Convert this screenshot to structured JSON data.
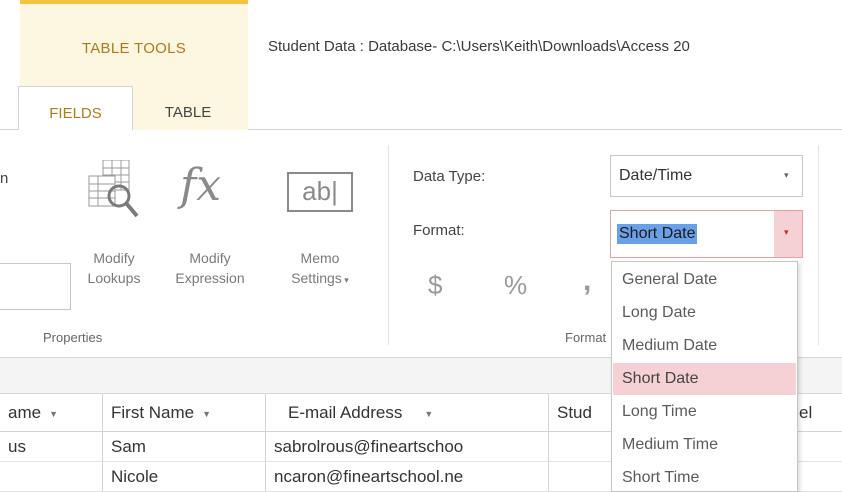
{
  "ribbon_header": {
    "context_group": "TABLE TOOLS",
    "document_title": "Student Data : Database- C:\\Users\\Keith\\Downloads\\Access 20"
  },
  "tabs": [
    {
      "label": "FIELDS",
      "active": true
    },
    {
      "label": "TABLE",
      "active": false
    }
  ],
  "properties_group": {
    "cut_text": "n",
    "modify_lookups": [
      "Modify",
      "Lookups"
    ],
    "modify_expression": [
      "Modify",
      "Expression"
    ],
    "memo_settings": [
      "Memo",
      "Settings"
    ],
    "memo_icon_text": "ab|",
    "fx_icon_text": "fx",
    "group_label": "Properties"
  },
  "formatting_group": {
    "data_type_label": "Data Type:",
    "data_type_value": "Date/Time",
    "format_label": "Format:",
    "format_value": "Short Date",
    "currency_symbol": "$",
    "percent_symbol": "%",
    "comma_symbol": ",",
    "group_label": "Format"
  },
  "format_dropdown": {
    "options": [
      "General Date",
      "Long Date",
      "Medium Date",
      "Short Date",
      "Long Time",
      "Medium Time",
      "Short Time"
    ],
    "selected": "Short Date"
  },
  "grid": {
    "columns": [
      "ame",
      "First Name",
      "E-mail Address",
      "Stud",
      "el"
    ],
    "rows": [
      [
        "us",
        "Sam",
        "sabrolrous@fineartschoo",
        "",
        ""
      ],
      [
        "",
        "Nicole",
        "ncaron@fineartschool.ne",
        "",
        ""
      ]
    ]
  },
  "colors": {
    "context_accent": "#f5c242",
    "context_bg": "#fdf6e0",
    "selected_highlight": "#f6d1d3"
  }
}
